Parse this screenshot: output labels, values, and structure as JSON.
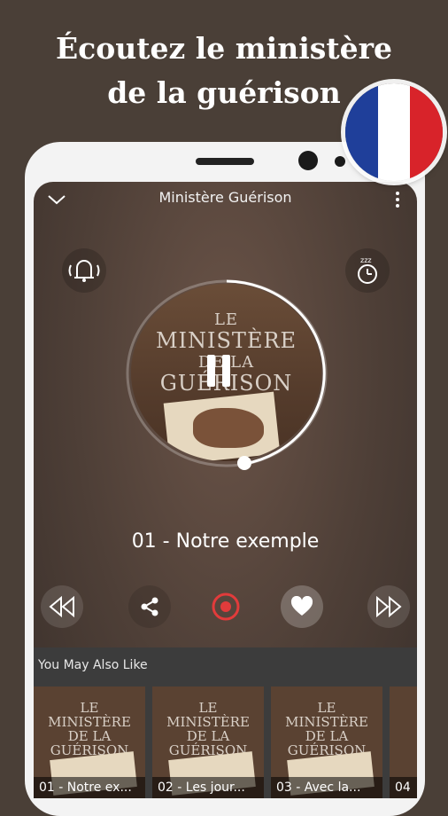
{
  "promo": {
    "line1": "Écoutez le ministère",
    "line2": "de la guérison"
  },
  "flag": {
    "colors": [
      "#1f3f9a",
      "#ffffff",
      "#d8232a"
    ]
  },
  "app": {
    "title": "Ministère Guérison",
    "icons": {
      "back": "chevron-down-icon",
      "menu": "more-vertical-icon",
      "alarm": "bell-icon",
      "sleep": "sleep-timer-icon"
    }
  },
  "cover": {
    "line1": "LE",
    "line2": "MINISTÈRE",
    "line3": "DE LA",
    "line4": "GUÉRISON"
  },
  "player": {
    "track_title": "01 - Notre exemple",
    "accent": "#e23b3b",
    "controls": [
      "rewind-icon",
      "share-icon",
      "record-icon",
      "heart-icon",
      "fast-forward-icon"
    ]
  },
  "suggestions": {
    "heading": "You May Also Like",
    "items": [
      {
        "label": "01 - Notre ex..."
      },
      {
        "label": "02 - Les jour..."
      },
      {
        "label": "03 - Avec la..."
      },
      {
        "label": "04"
      }
    ]
  }
}
